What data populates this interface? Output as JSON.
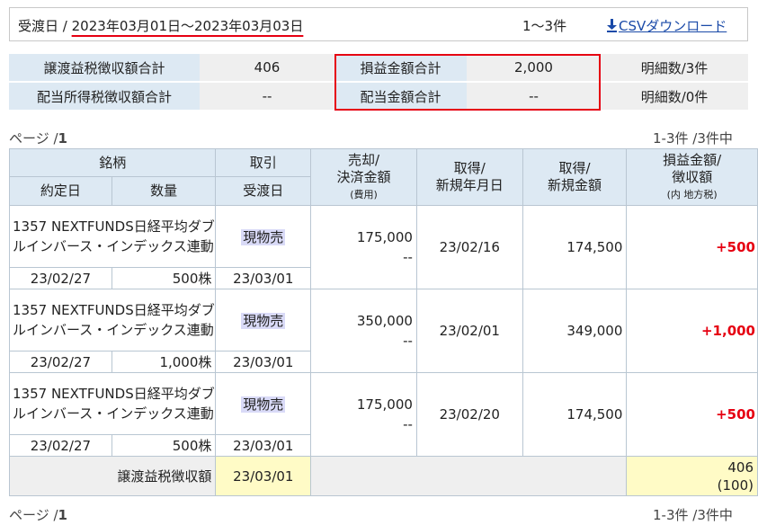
{
  "header": {
    "period_label": "受渡日",
    "separator": "/",
    "date_range": "2023年03月01日～2023年03月03日",
    "count": "1～3件",
    "csv_link": "CSVダウンロード"
  },
  "summary": [
    {
      "left_label": "譲渡益税徴収額合計",
      "left_value": "406",
      "right_label": "損益金額合計",
      "right_value": "2,000",
      "detail": "明細数/3件"
    },
    {
      "left_label": "配当所得税徴収額合計",
      "left_value": "--",
      "right_label": "配当金額合計",
      "right_value": "--",
      "detail": "明細数/0件"
    }
  ],
  "pager": {
    "page_label": "ページ /",
    "page_num": "1",
    "range": "1-3件 /3件中"
  },
  "columns": {
    "meigara": "銘柄",
    "torihiki": "取引",
    "baikyaku": "売却/",
    "kessai": "決済金額",
    "hiyou": "(費用)",
    "shutoku1": "取得/",
    "shutoku_date": "新規年月日",
    "shutoku2": "取得/",
    "shutoku_amount": "新規金額",
    "soneki": "損益金額/",
    "choshu": "徴収額",
    "chihou": "(内 地方税)",
    "yakujo": "約定日",
    "suryo": "数量",
    "ukewatashi": "受渡日"
  },
  "rows": [
    {
      "name": "1357 NEXTFUNDS日経平均ダブルインバース・インデックス連動",
      "trade": "現物売",
      "sale": "175,000",
      "fee": "--",
      "acq_date": "23/02/16",
      "acq_amount": "174,500",
      "pl": "+500",
      "contract_date": "23/02/27",
      "qty": "500株",
      "delivery": "23/03/01"
    },
    {
      "name": "1357 NEXTFUNDS日経平均ダブルインバース・インデックス連動",
      "trade": "現物売",
      "sale": "350,000",
      "fee": "--",
      "acq_date": "23/02/01",
      "acq_amount": "349,000",
      "pl": "+1,000",
      "contract_date": "23/02/27",
      "qty": "1,000株",
      "delivery": "23/03/01"
    },
    {
      "name": "1357 NEXTFUNDS日経平均ダブルインバース・インデックス連動",
      "trade": "現物売",
      "sale": "175,000",
      "fee": "--",
      "acq_date": "23/02/20",
      "acq_amount": "174,500",
      "pl": "+500",
      "contract_date": "23/02/27",
      "qty": "500株",
      "delivery": "23/03/01"
    }
  ],
  "footer": {
    "label": "譲渡益税徴収額",
    "date": "23/03/01",
    "tax": "406",
    "local_tax": "(100)"
  },
  "colors": {
    "header_bg": "#dde9f3",
    "highlight_red": "#e60012",
    "trade_bg": "#d9daf7",
    "footer_yellow": "#fffbc6",
    "link": "#1a4aa8"
  }
}
